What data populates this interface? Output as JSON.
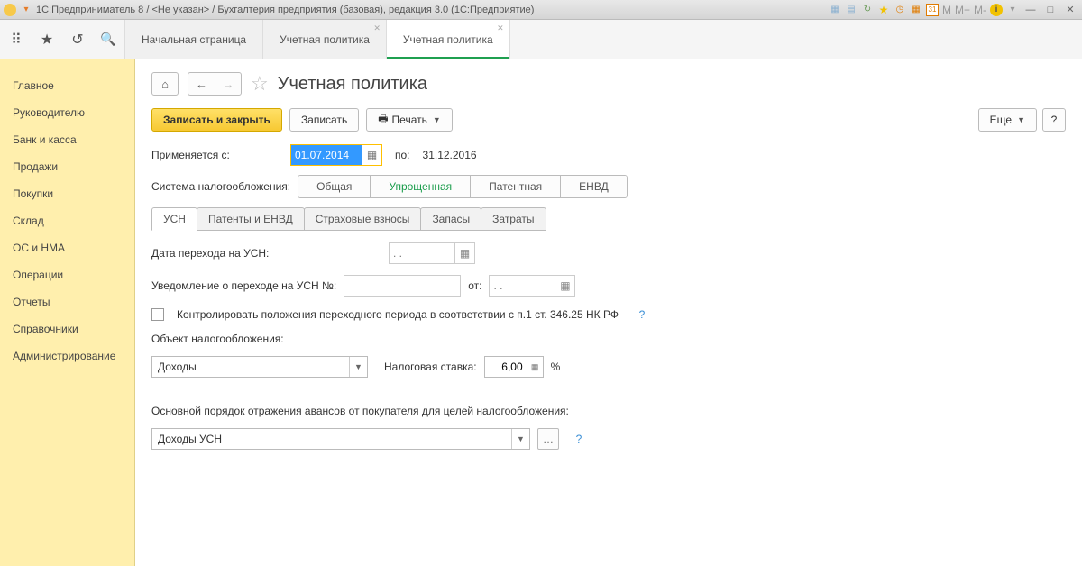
{
  "titlebar": {
    "text": "1С:Предприниматель 8 / <Не указан> / Бухгалтерия предприятия (базовая), редакция 3.0  (1С:Предприятие)",
    "m_labels": [
      "M",
      "M+",
      "M-"
    ]
  },
  "tabs": [
    {
      "label": "Начальная страница",
      "closable": false,
      "active": false
    },
    {
      "label": "Учетная политика",
      "closable": true,
      "active": false
    },
    {
      "label": "Учетная политика",
      "closable": true,
      "active": true
    }
  ],
  "sidebar": {
    "items": [
      "Главное",
      "Руководителю",
      "Банк и касса",
      "Продажи",
      "Покупки",
      "Склад",
      "ОС и НМА",
      "Операции",
      "Отчеты",
      "Справочники",
      "Администрирование"
    ]
  },
  "page": {
    "title": "Учетная политика",
    "btn_save_close": "Записать и закрыть",
    "btn_save": "Записать",
    "btn_print": "Печать",
    "btn_more": "Еще",
    "lbl_applies_from": "Применяется с:",
    "date_from": "01.07.2014",
    "lbl_to": "по:",
    "date_to": "31.12.2016",
    "lbl_tax_system": "Система налогообложения:",
    "tax_segments": [
      "Общая",
      "Упрощенная",
      "Патентная",
      "ЕНВД"
    ],
    "tax_active_index": 1,
    "inner_tabs": [
      "УСН",
      "Патенты и ЕНВД",
      "Страховые взносы",
      "Запасы",
      "Затраты"
    ],
    "inner_active_index": 0,
    "usn": {
      "lbl_transition_date": "Дата перехода на УСН:",
      "transition_date_placeholder": ". .",
      "lbl_notice_num": "Уведомление о переходе на УСН №:",
      "lbl_notice_from": "от:",
      "notice_date_placeholder": ". .",
      "chk_label": "Контролировать положения переходного периода в соответствии с п.1 ст. 346.25 НК РФ",
      "lbl_tax_object": "Объект налогообложения:",
      "tax_object_value": "Доходы",
      "lbl_tax_rate": "Налоговая ставка:",
      "tax_rate_value": "6,00",
      "tax_rate_unit": "%",
      "lbl_advance_order": "Основной порядок отражения авансов от покупателя для целей налогообложения:",
      "advance_value": "Доходы УСН"
    }
  }
}
